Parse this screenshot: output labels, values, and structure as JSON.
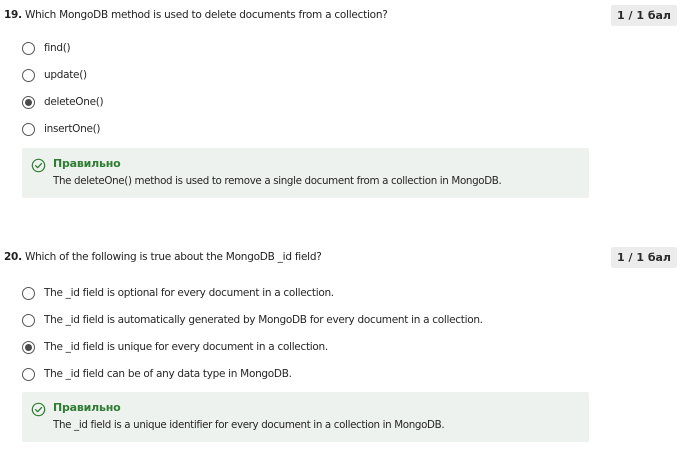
{
  "questions": [
    {
      "number": "19.",
      "text": "Which MongoDB method is used to delete documents from a collection?",
      "score": "1 / 1 бал",
      "options": [
        {
          "label": "find()",
          "selected": false
        },
        {
          "label": "update()",
          "selected": false
        },
        {
          "label": "deleteOne()",
          "selected": true
        },
        {
          "label": "insertOne()",
          "selected": false
        }
      ],
      "feedback": {
        "title": "Правильно",
        "text": "The deleteOne() method is used to remove a single document from a collection in MongoDB.",
        "icon": "check-circle-icon"
      }
    },
    {
      "number": "20.",
      "text": "Which of the following is true about the MongoDB _id field?",
      "score": "1 / 1 бал",
      "options": [
        {
          "label": "The _id field is optional for every document in a collection.",
          "selected": false
        },
        {
          "label": "The _id field is automatically generated by MongoDB for every document in a collection.",
          "selected": false
        },
        {
          "label": "The _id field is unique for every document in a collection.",
          "selected": true
        },
        {
          "label": "The _id field can be of any data type in MongoDB.",
          "selected": false
        }
      ],
      "feedback": {
        "title": "Правильно",
        "text": "The _id field is a unique identifier for every document in a collection in MongoDB.",
        "icon": "check-circle-icon"
      }
    }
  ],
  "colors": {
    "correct": "#2e7d32",
    "feedback_bg": "#eef2ee",
    "badge_bg": "#ececec"
  }
}
